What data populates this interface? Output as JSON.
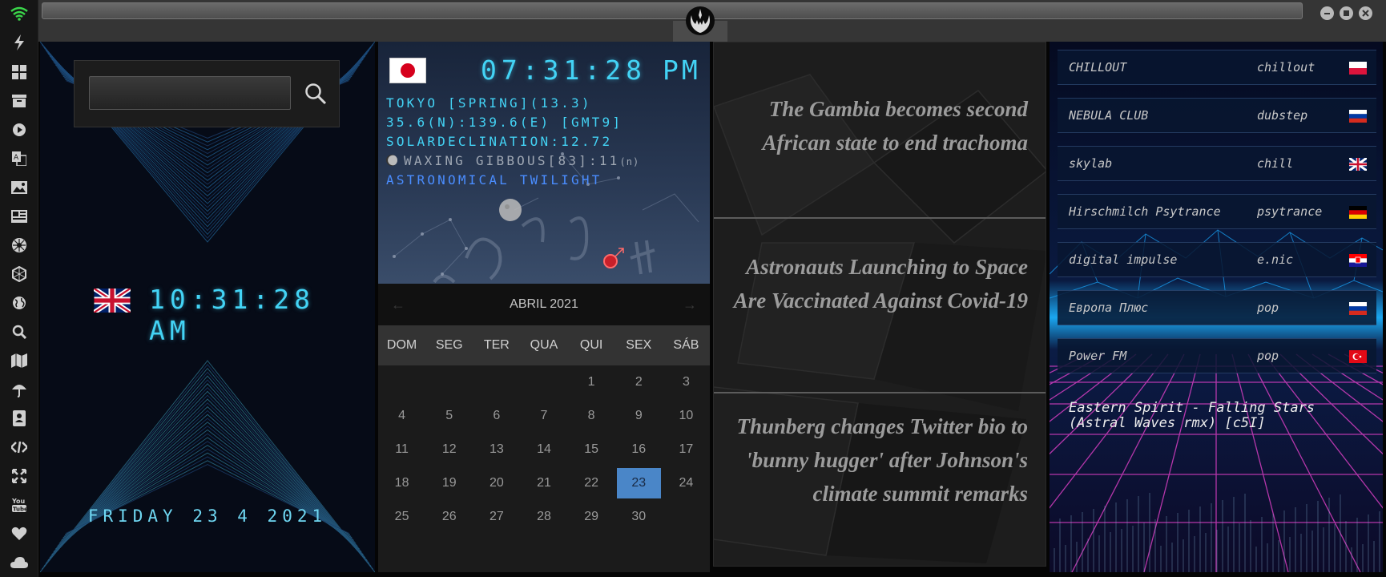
{
  "sidebar": {
    "icons": [
      "wifi-icon",
      "bolt-icon",
      "windows-icon",
      "archive-icon",
      "play-icon",
      "translate-icon",
      "image-icon",
      "news-icon",
      "settings-icon",
      "hexagon-icon",
      "globe-icon",
      "search-icon",
      "map-icon",
      "umbrella-icon",
      "contacts-icon",
      "code-icon",
      "fullscreen-icon",
      "youtube-icon",
      "heart-icon",
      "cloud-icon"
    ]
  },
  "titlebar": {
    "logo": "rebel-alliance-logo",
    "buttons": [
      "minimize",
      "maximize",
      "close"
    ]
  },
  "local_clock": {
    "flag": "uk-flag",
    "time": "10:31:28",
    "ampm": "AM",
    "date": "FRIDAY 23 4 2021"
  },
  "search": {
    "value": "",
    "placeholder": ""
  },
  "tokyo": {
    "flag": "japan-flag",
    "time": "07:31:28",
    "ampm": "PM",
    "line1": "TOKYO [SPRING](13.3)",
    "line2": "35.6(N):139.6(E) [GMT9]",
    "line3": "SOLARDECLINATION:12.72",
    "line4": "WAXING GIBBOUS[83]:11",
    "line4_suffix": "(n)",
    "line5": "ASTRONOMICAL TWILIGHT"
  },
  "calendar": {
    "month_label": "ABRIL 2021",
    "prev": "←",
    "next": "→",
    "day_names": [
      "DOM",
      "SEG",
      "TER",
      "QUA",
      "QUI",
      "SEX",
      "SÁB"
    ],
    "weeks": [
      [
        "",
        "",
        "",
        "",
        "1",
        "2",
        "3"
      ],
      [
        "4",
        "5",
        "6",
        "7",
        "8",
        "9",
        "10"
      ],
      [
        "11",
        "12",
        "13",
        "14",
        "15",
        "16",
        "17"
      ],
      [
        "18",
        "19",
        "20",
        "21",
        "22",
        "23",
        "24"
      ],
      [
        "25",
        "26",
        "27",
        "28",
        "29",
        "30",
        ""
      ]
    ],
    "selected": "23"
  },
  "news": [
    {
      "headline": "The Gambia becomes second African state to end trachoma"
    },
    {
      "headline": "Astronauts Launching to Space Are Vaccinated Against Covid-19"
    },
    {
      "headline": "Thunberg changes Twitter bio to 'bunny hugger' after Johnson's climate summit remarks"
    }
  ],
  "radio": {
    "stations": [
      {
        "name": "CHILLOUT",
        "genre": "chillout",
        "flag": "poland-flag"
      },
      {
        "name": "NEBULA CLUB",
        "genre": "dubstep",
        "flag": "russia-flag"
      },
      {
        "name": "skylab",
        "genre": "chill",
        "flag": "uk-flag"
      },
      {
        "name": "Hirschmilch Psytrance",
        "genre": "psytrance",
        "flag": "germany-flag"
      },
      {
        "name": "digital impulse",
        "genre": "e.nic",
        "flag": "croatia-flag"
      },
      {
        "name": "Европа Плюс",
        "genre": "pop",
        "flag": "russia-flag"
      },
      {
        "name": "Power FM",
        "genre": "pop",
        "flag": "turkey-flag"
      }
    ],
    "now_playing": "Eastern Spirit - Falling Stars (Astral Waves rmx) [c5I]"
  }
}
